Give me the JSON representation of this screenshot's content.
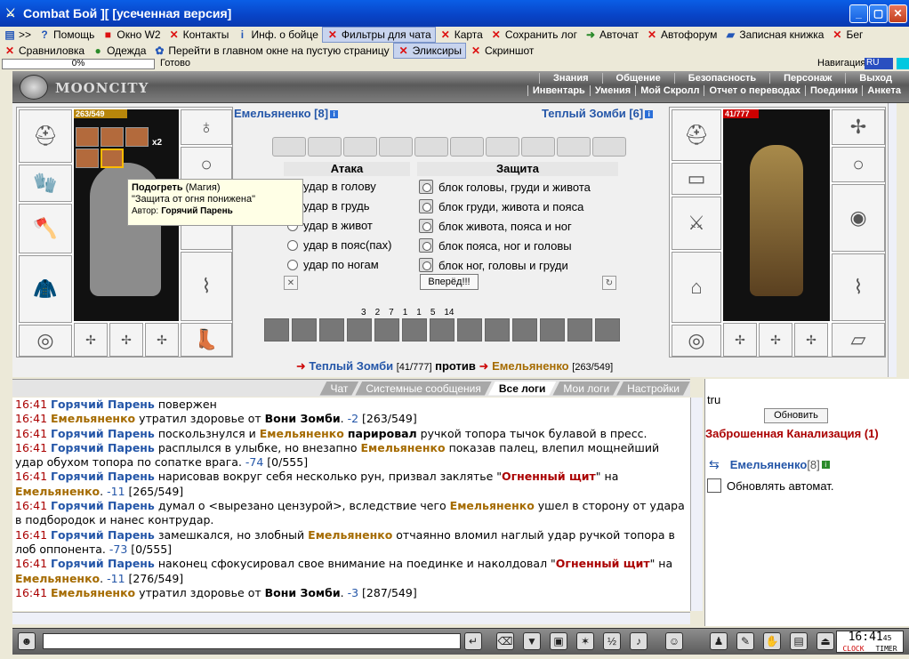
{
  "window": {
    "title": "Combat Бой ][ [усеченная версия]"
  },
  "menu1": [
    {
      "icon": "doc-icon",
      "label": ">>"
    },
    {
      "icon": "help-icon",
      "label": "Помощь"
    },
    {
      "icon": "window-icon",
      "label": "Окно W2"
    },
    {
      "icon": "x-icon",
      "label": "Контакты"
    },
    {
      "icon": "info-icon",
      "label": "Инф. о бойце"
    },
    {
      "icon": "x-icon",
      "label": "Фильтры для чата"
    },
    {
      "icon": "x-icon",
      "label": "Карта"
    },
    {
      "icon": "x-icon",
      "label": "Сохранить лог"
    },
    {
      "icon": "arrow-icon",
      "label": "Авточат"
    },
    {
      "icon": "x-icon",
      "label": "Автофорум"
    },
    {
      "icon": "book-icon",
      "label": "Записная книжка"
    },
    {
      "icon": "x-icon",
      "label": "Бег"
    }
  ],
  "menu2": [
    {
      "icon": "x-icon",
      "label": "Сравниловка"
    },
    {
      "icon": "globe-icon",
      "label": "Одежда"
    },
    {
      "icon": "gear-icon",
      "label": "Перейти в главном окне на пустую страницу"
    },
    {
      "icon": "x-icon",
      "label": "Эликсиры"
    },
    {
      "icon": "x-icon",
      "label": "Скриншот"
    }
  ],
  "status": {
    "progress": "0%",
    "text": "Готово",
    "nav_label": "Навигация",
    "nav_value": "RU"
  },
  "banner": {
    "logo_text": "MOONCITY",
    "top_tabs": [
      "Знания",
      "Общение",
      "Безопасность",
      "Персонаж",
      "Выход"
    ],
    "sub_tabs": [
      "Инвентарь",
      "Умения",
      "Мой Скролл",
      "Отчет о переводах",
      "Поединки",
      "Анкета"
    ]
  },
  "player": {
    "name": "Емельяненко [8]",
    "hp": "263/549",
    "bonus": "x2"
  },
  "enemy": {
    "name": "Теплый Зомби [6]",
    "hp": "41/777"
  },
  "tooltip": {
    "title": "Подогреть",
    "type": "(Магия)",
    "desc": "\"Защита от огня понижена\"",
    "author_label": "Автор:",
    "author": "Горячий Парень"
  },
  "combat": {
    "attack_header": "Атака",
    "defense_header": "Защита",
    "attacks": [
      "удар в голову",
      "удар в грудь",
      "удар в живот",
      "удар в пояс(пах)",
      "удар по ногам"
    ],
    "defenses": [
      "блок головы, груди и живота",
      "блок груди, живота и пояса",
      "блок живота, пояса и ног",
      "блок пояса, ног и головы",
      "блок ног, головы и груди"
    ],
    "go_button": "Вперёд!!!",
    "counters": [
      "3",
      "2",
      "7",
      "1",
      "1",
      "5",
      "14"
    ]
  },
  "versus": {
    "left": "Теплый Зомби",
    "left_hp": "[41/777]",
    "mid": "против",
    "right": "Емельяненко",
    "right_hp": "[263/549]"
  },
  "chat_tabs": [
    "Чат",
    "Системные сообщения",
    "Все логи",
    "Мои логи",
    "Настройки"
  ],
  "log": [
    {
      "time": "16:41",
      "html": "<span class='p1'>Горячий Парень</span> повержен"
    },
    {
      "time": "16:41",
      "html": "<span class='p2'>Емельяненко</span> утратил здоровье от <b>Вони Зомби</b>. <span class='dmg'>-2</span> [263/549]"
    },
    {
      "time": "16:41",
      "html": "<span class='p1'>Горячий Парень</span> поскользнулся и <span class='p2'>Емельяненко</span> <b>парировал</b> ручкой топора тычок булавой в пресс."
    },
    {
      "time": "16:41",
      "html": "<span class='p1'>Горячий Парень</span> расплылся в улыбке, но внезапно <span class='p2'>Емельяненко</span> показав палец, влепил мощнейший удар обухом топора по сопатке врага. <span class='dmg'>-74</span> [0/555]"
    },
    {
      "time": "16:41",
      "html": "<span class='p1'>Горячий Парень</span> нарисовав вокруг себя несколько рун, призвал заклятье \"<span class='spell'>Огненный щит</span>\" на <span class='p2'>Емельяненко</span>. <span class='dmg'>-11</span> [265/549]"
    },
    {
      "time": "16:41",
      "html": "<span class='p1'>Горячий Парень</span> думал о &lt;вырезано цензурой&gt;, вследствие чего <span class='p2'>Емельяненко</span> ушел в сторону от удара в подбородок и нанес контрудар."
    },
    {
      "time": "16:41",
      "html": "<span class='p1'>Горячий Парень</span> замешкался, но злобный <span class='p2'>Емельяненко</span> отчаянно вломил наглый удар ручкой топора в лоб оппонента. <span class='dmg'>-73</span> [0/555]"
    },
    {
      "time": "16:41",
      "html": "<span class='p1'>Горячий Парень</span> наконец сфокусировал свое внимание на поединке и наколдовал \"<span class='spell'>Огненный щит</span>\" на <span class='p2'>Емельяненко</span>. <span class='dmg'>-11</span> [276/549]"
    },
    {
      "time": "16:41",
      "html": "<span class='p2'>Емельяненко</span> утратил здоровье от <b>Вони Зомби</b>. <span class='dmg'>-3</span> [287/549]"
    }
  ],
  "right": {
    "tru": "tru",
    "refresh": "Обновить",
    "location": "Заброшенная Канализация (1)",
    "member": "Емельяненко",
    "member_level": "[8]",
    "auto": "Обновлять автомат."
  },
  "clock": {
    "time": "16:41",
    "sec": "45",
    "clock_label": "CLOCK",
    "timer_label": "TIMER"
  }
}
